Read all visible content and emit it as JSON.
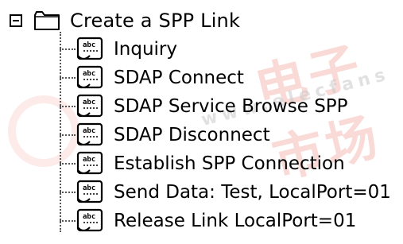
{
  "tree": {
    "root": {
      "label": "Create a SPP Link",
      "expander_icon": "collapse-minus-icon",
      "icon": "folder-icon"
    },
    "children": [
      {
        "label": "Inquiry",
        "icon": "script-doc-icon"
      },
      {
        "label": "SDAP Connect",
        "icon": "script-doc-icon"
      },
      {
        "label": "SDAP Service Browse SPP",
        "icon": "script-doc-icon"
      },
      {
        "label": "SDAP Disconnect",
        "icon": "script-doc-icon"
      },
      {
        "label": "Establish SPP Connection",
        "icon": "script-doc-icon"
      },
      {
        "label": "Send Data: Test, LocalPort=01",
        "icon": "script-doc-icon"
      },
      {
        "label": "Release Link LocalPort=01",
        "icon": "script-doc-icon"
      }
    ]
  },
  "colors": {
    "background": "#ffffff",
    "text": "#000000",
    "watermark": "#e03a2a"
  }
}
